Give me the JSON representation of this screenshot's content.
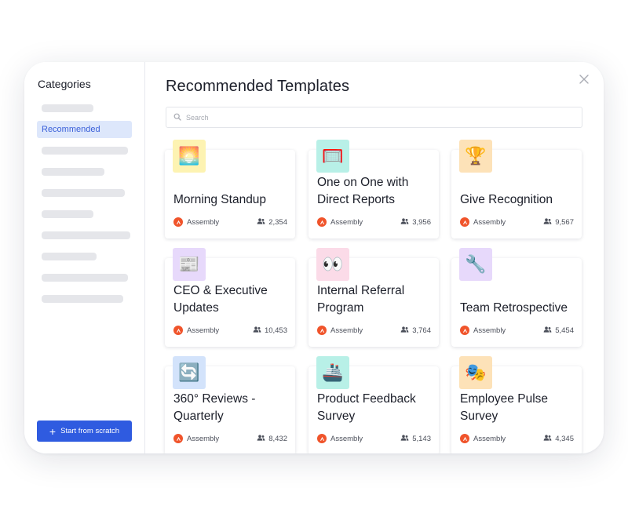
{
  "sidebar": {
    "heading": "Categories",
    "active_category": "Recommended",
    "scratch_button": "Start from scratch"
  },
  "main": {
    "title": "Recommended Templates",
    "search_placeholder": "Search"
  },
  "templates": [
    {
      "title": "Morning Standup",
      "org": "Assembly",
      "users": "2,354",
      "icon": "sunrise-emoji",
      "emoji": "🌅",
      "tile_color": "#fdf3b2"
    },
    {
      "title": "One on One with Direct Reports",
      "org": "Assembly",
      "users": "3,956",
      "icon": "goal-net-emoji",
      "emoji": "🥅",
      "tile_color": "#b8f0e7"
    },
    {
      "title": "Give Recognition",
      "org": "Assembly",
      "users": "9,567",
      "icon": "trophy-emoji",
      "emoji": "🏆",
      "tile_color": "#fde2b8"
    },
    {
      "title": "CEO & Executive Updates",
      "org": "Assembly",
      "users": "10,453",
      "icon": "newspaper-emoji",
      "emoji": "📰",
      "tile_color": "#e7d9fb"
    },
    {
      "title": "Internal Referral Program",
      "org": "Assembly",
      "users": "3,764",
      "icon": "eyes-emoji",
      "emoji": "👀",
      "tile_color": "#fbdbe8"
    },
    {
      "title": "Team Retrospective",
      "org": "Assembly",
      "users": "5,454",
      "icon": "wrench-emoji",
      "emoji": "🔧",
      "tile_color": "#e7d9fb"
    },
    {
      "title": "360° Reviews - Quarterly",
      "org": "Assembly",
      "users": "8,432",
      "icon": "arrows-cycle-emoji",
      "emoji": "🔄",
      "tile_color": "#d3e3fb"
    },
    {
      "title": "Product Feedback Survey",
      "org": "Assembly",
      "users": "5,143",
      "icon": "ship-emoji",
      "emoji": "🚢",
      "tile_color": "#b8f0e7"
    },
    {
      "title": "Employee Pulse Survey",
      "org": "Assembly",
      "users": "4,345",
      "icon": "theater-masks-emoji",
      "emoji": "🎭",
      "tile_color": "#fde2b8"
    }
  ]
}
